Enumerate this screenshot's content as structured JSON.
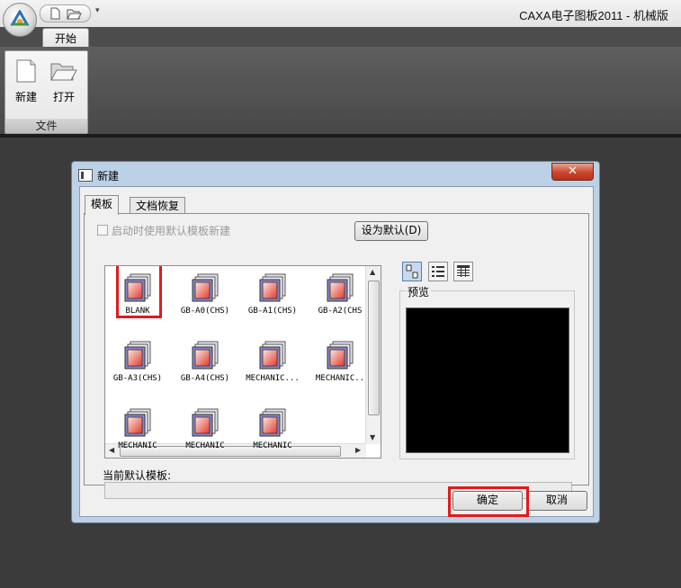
{
  "window": {
    "title": "CAXA电子图板2011 - 机械版"
  },
  "ribbon": {
    "tabs": [
      {
        "label": "开始"
      }
    ],
    "group": {
      "label": "文件",
      "buttons": [
        {
          "label": "新建",
          "icon": "new-document-icon"
        },
        {
          "label": "打开",
          "icon": "open-folder-icon"
        }
      ]
    }
  },
  "dialog": {
    "title": "新建",
    "close_glyph": "✕",
    "tabs": [
      {
        "label": "模板"
      },
      {
        "label": "文档恢复"
      }
    ],
    "startup_checkbox": {
      "label": "启动时使用默认模板新建",
      "checked": false,
      "enabled": false
    },
    "set_default_button": "设为默认(D)",
    "templates": [
      {
        "label": "BLANK",
        "selected": true
      },
      {
        "label": "GB-A0(CHS)"
      },
      {
        "label": "GB-A1(CHS)"
      },
      {
        "label": "GB-A2(CHS"
      },
      {
        "label": "GB-A3(CHS)"
      },
      {
        "label": "GB-A4(CHS)"
      },
      {
        "label": "MECHANIC..."
      },
      {
        "label": "MECHANIC.."
      },
      {
        "label": "MECHANIC"
      },
      {
        "label": "MECHANIC"
      },
      {
        "label": "MECHANIC"
      }
    ],
    "view_modes": [
      "large-icons-view-icon",
      "list-view-icon",
      "details-view-icon"
    ],
    "preview_label": "预览",
    "current_default_label": "当前默认模板:",
    "current_default_value": "",
    "ok_button": "确定",
    "cancel_button": "取消"
  },
  "colors": {
    "highlight": "#e01b1b",
    "dialog_frame": "#bcd1e6",
    "ribbon_dark": "#4c4c4c",
    "preview_background": "#000000"
  }
}
